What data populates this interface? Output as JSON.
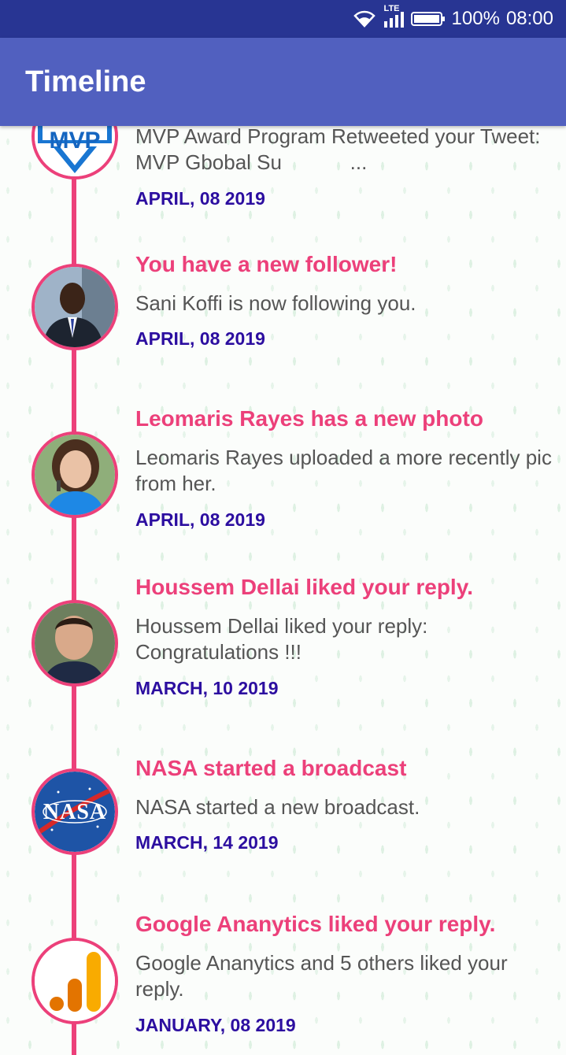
{
  "status_bar": {
    "network": "LTE",
    "battery": "100%",
    "time": "08:00"
  },
  "app_bar": {
    "title": "Timeline"
  },
  "items": [
    {
      "avatar_text": "MVP",
      "body": "MVP Award Program Retweeted your Tweet: MVP Gbobal Su            ...",
      "date": "APRIL, 08 2019"
    },
    {
      "title": "You have a new follower!",
      "body": "Sani Koffi is now following you.",
      "date": "APRIL, 08 2019"
    },
    {
      "title": "Leomaris Rayes has a new photo",
      "body": "Leomaris Rayes uploaded a more recently pic from her.",
      "date": "APRIL, 08 2019"
    },
    {
      "title": "Houssem Dellai liked your reply.",
      "body": "Houssem Dellai liked your reply: Congratulations !!!",
      "date": "MARCH, 10 2019"
    },
    {
      "title": "NASA started a broadcast",
      "avatar_text": "NASA",
      "body": "NASA started a new broadcast.",
      "date": "MARCH, 14 2019"
    },
    {
      "title": "Google Ananytics liked your reply.",
      "body": "Google Ananytics and 5 others liked your reply.",
      "date": "JANUARY, 08 2019"
    }
  ],
  "colors": {
    "accent": "#ec407a",
    "date": "#2c0ea0",
    "app_bar": "#5160bf",
    "status_bar": "#283593"
  }
}
